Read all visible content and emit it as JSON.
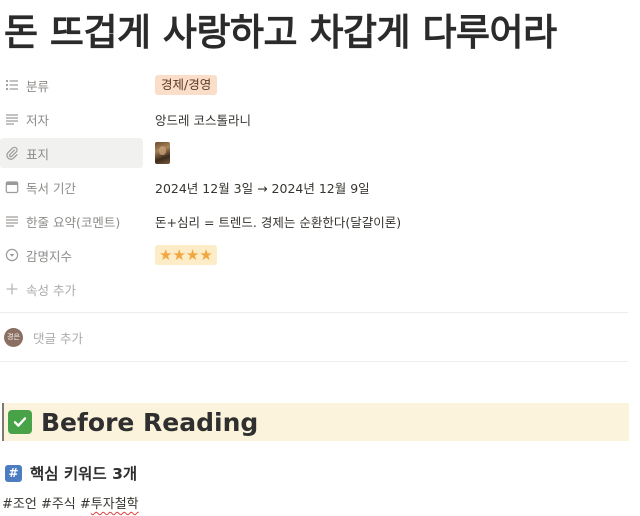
{
  "page": {
    "title": "돈 뜨겁게 사랑하고 차갑게 다루어라"
  },
  "properties": {
    "category": {
      "label": "분류",
      "value": "경제/경영",
      "icon": "list-icon"
    },
    "author": {
      "label": "저자",
      "value": "앙드레 코스톨라니",
      "icon": "text-lines-icon"
    },
    "cover": {
      "label": "표지",
      "icon": "paperclip-icon"
    },
    "reading_period": {
      "label": "독서 기간",
      "value": "2024년 12월 3일 → 2024년 12월 9일",
      "icon": "calendar-icon"
    },
    "summary": {
      "label": "한줄 요약(코멘트)",
      "value": "돈+심리 = 트렌드. 경제는 순환한다(달걀이론)",
      "icon": "text-lines-icon"
    },
    "rating": {
      "label": "감명지수",
      "value": "★★★★",
      "stars": 4,
      "icon": "select-circle-icon"
    },
    "add_property": {
      "label": "속성 추가",
      "icon": "plus-icon"
    }
  },
  "comments": {
    "avatar_text": "경은",
    "placeholder": "댓글 추가"
  },
  "callout": {
    "icon": "check-mark-icon",
    "title": "Before Reading"
  },
  "keywords": {
    "icon": "hash-icon",
    "icon_text": "#",
    "title": "핵심 키워드 3개",
    "tags_prefix": "#조언 #주식 #",
    "tags_squiggle": "투자철학"
  },
  "colors": {
    "tag_bg": "#fadec9",
    "rating_bg": "#fdecc8",
    "callout_bg": "#fbf3db",
    "check_green": "#47a248",
    "hash_blue": "#4c7dc0"
  }
}
